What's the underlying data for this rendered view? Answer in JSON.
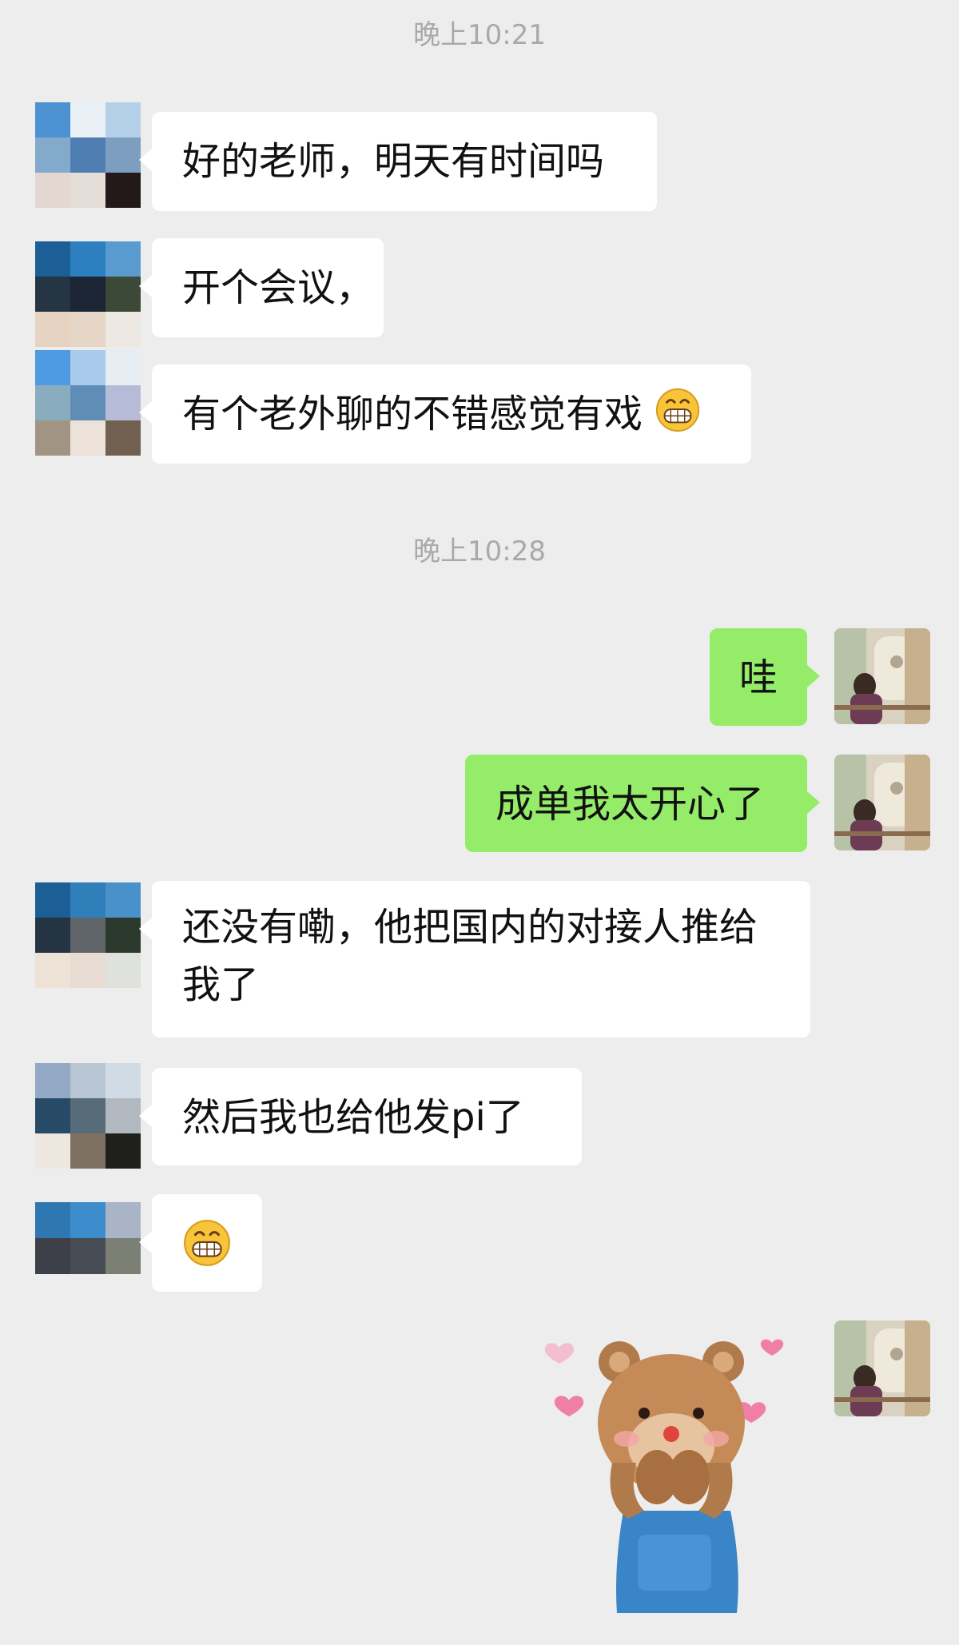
{
  "chat": {
    "times": [
      "晚上10:21",
      "晚上10:28"
    ],
    "messages": [
      {
        "side": "left",
        "text": "好的老师，明天有时间吗"
      },
      {
        "side": "left",
        "text": "开个会议，"
      },
      {
        "side": "left",
        "text": "有个老外聊的不错感觉有戏",
        "emoji": "grinning-emoji"
      },
      {
        "side": "right",
        "text": "哇"
      },
      {
        "side": "right",
        "text": "成单我太开心了"
      },
      {
        "side": "left",
        "text": "还没有嘞，他把国内的对接人推给我了"
      },
      {
        "side": "left",
        "text": "然后我也给他发pi了"
      },
      {
        "side": "left",
        "text": "",
        "emoji": "grinning-emoji"
      },
      {
        "side": "right",
        "sticker": "bear-sticker"
      }
    ]
  },
  "colors": {
    "background": "#ededed",
    "incoming_bubble": "#ffffff",
    "outgoing_bubble": "#95ec69",
    "timestamp": "#a9a9a9",
    "text": "#111111"
  }
}
